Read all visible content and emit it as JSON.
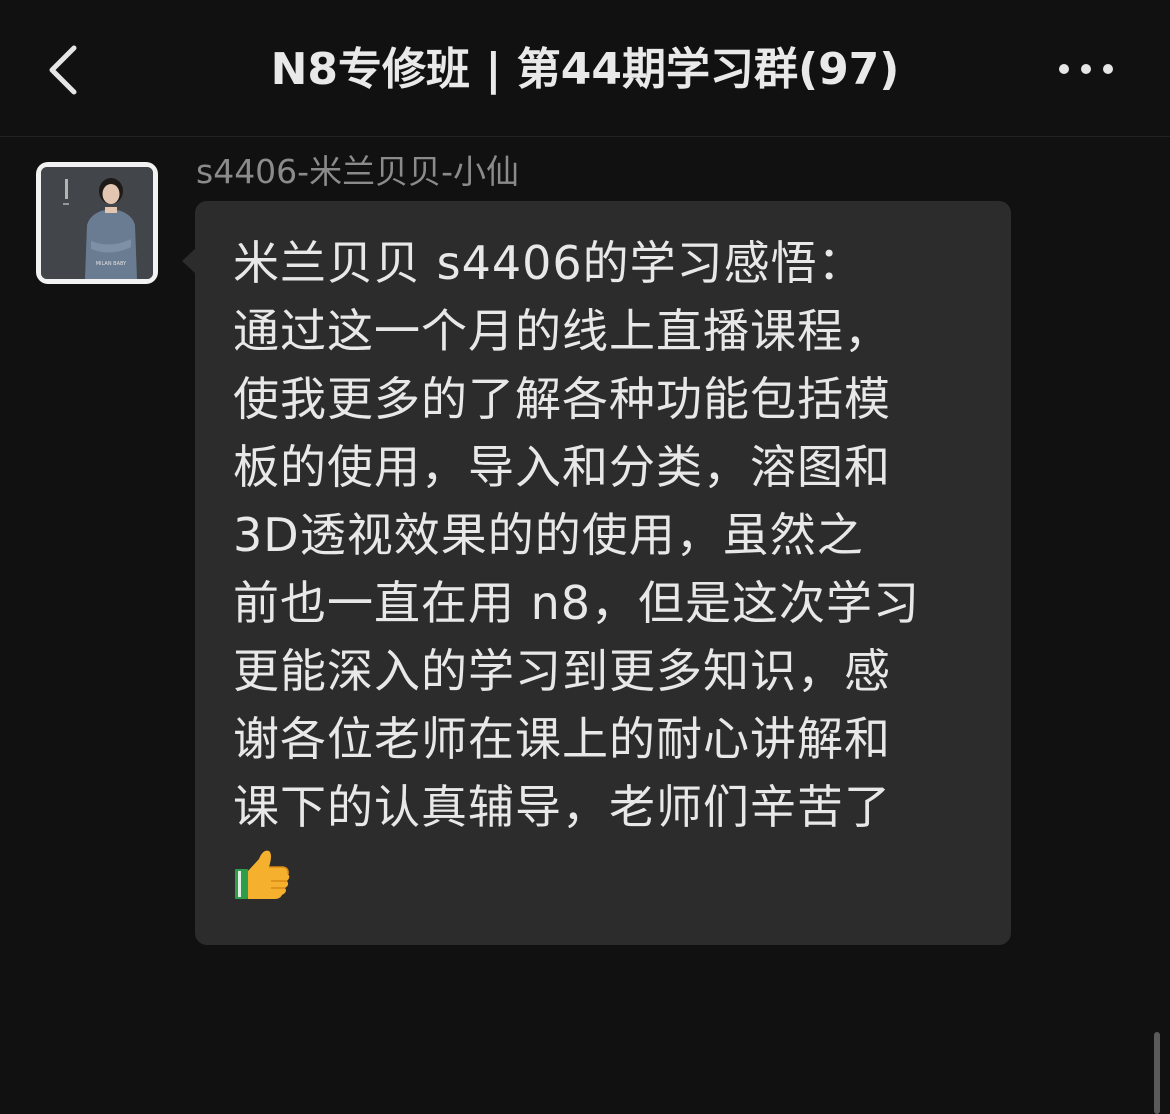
{
  "header": {
    "back_icon": "chevron-left-icon",
    "title": "N8专修班 | 第44期学习群(97)",
    "more_icon": "ellipsis-icon"
  },
  "message": {
    "sender": "s4406-米兰贝贝-小仙",
    "avatar": {
      "brand_text": "MILAN BABY",
      "accent": "#d8d8d8"
    },
    "lines": [
      "米兰贝贝 s4406的学习感悟：",
      "通过这一个月的线上直播课程，",
      "使我更多的了解各种功能包括模",
      "板的使用，导入和分类，溶图和",
      "3D透视效果的的使用，虽然之",
      "前也一直在用 n8，但是这次学习",
      "更能深入的学习到更多知识，感",
      "谢各位老师在课上的耐心讲解和",
      "课下的认真辅导，老师们辛苦了"
    ],
    "emoji": "thumbs-up-icon"
  },
  "colors": {
    "background": "#111111",
    "bubble": "#2c2c2c",
    "text": "#e8e8e8",
    "sender_name": "#8b8b8b"
  }
}
